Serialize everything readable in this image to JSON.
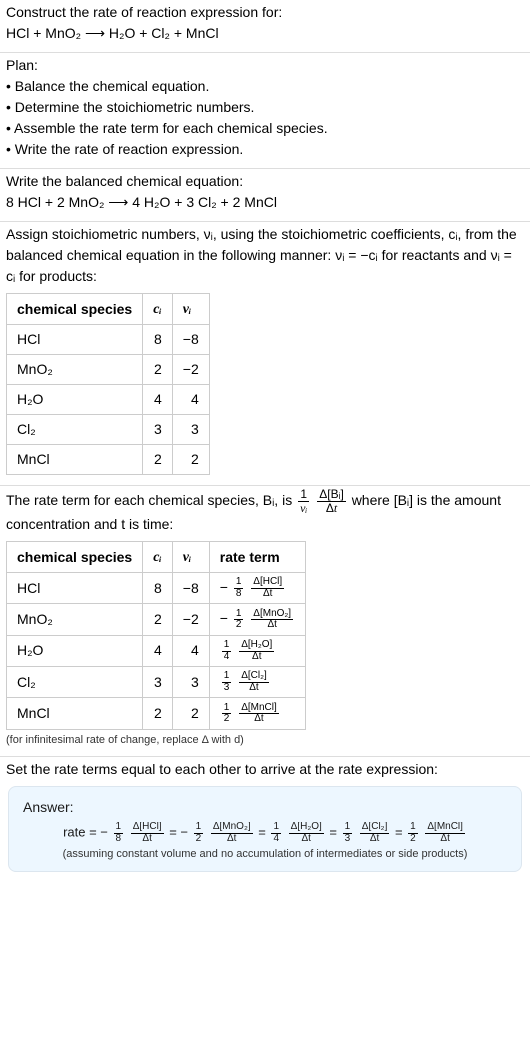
{
  "prompt": {
    "line1": "Construct the rate of reaction expression for:",
    "eq": "HCl + MnO₂ ⟶ H₂O + Cl₂ + MnCl"
  },
  "plan": {
    "heading": "Plan:",
    "items": [
      "• Balance the chemical equation.",
      "• Determine the stoichiometric numbers.",
      "• Assemble the rate term for each chemical species.",
      "• Write the rate of reaction expression."
    ]
  },
  "balanced": {
    "heading": "Write the balanced chemical equation:",
    "eq": "8 HCl + 2 MnO₂ ⟶ 4 H₂O + 3 Cl₂ + 2 MnCl"
  },
  "stoich": {
    "intro": "Assign stoichiometric numbers, νᵢ, using the stoichiometric coefficients, cᵢ, from the balanced chemical equation in the following manner: νᵢ = −cᵢ for reactants and νᵢ = cᵢ for products:",
    "headers": [
      "chemical species",
      "cᵢ",
      "νᵢ"
    ],
    "rows": [
      {
        "sp": "HCl",
        "c": "8",
        "v": "−8"
      },
      {
        "sp": "MnO₂",
        "c": "2",
        "v": "−2"
      },
      {
        "sp": "H₂O",
        "c": "4",
        "v": "4"
      },
      {
        "sp": "Cl₂",
        "c": "3",
        "v": "3"
      },
      {
        "sp": "MnCl",
        "c": "2",
        "v": "2"
      }
    ]
  },
  "rateterm": {
    "intro_a": "The rate term for each chemical species, Bᵢ, is ",
    "intro_b": " where [Bᵢ] is the amount concentration and t is time:",
    "headers": [
      "chemical species",
      "cᵢ",
      "νᵢ",
      "rate term"
    ],
    "rows": [
      {
        "sp": "HCl",
        "c": "8",
        "v": "−8",
        "rt_sign": "−",
        "rt_num": "1",
        "rt_den": "8",
        "rt_dnum": "Δ[HCl]",
        "rt_dden": "Δt"
      },
      {
        "sp": "MnO₂",
        "c": "2",
        "v": "−2",
        "rt_sign": "−",
        "rt_num": "1",
        "rt_den": "2",
        "rt_dnum": "Δ[MnO₂]",
        "rt_dden": "Δt"
      },
      {
        "sp": "H₂O",
        "c": "4",
        "v": "4",
        "rt_sign": "",
        "rt_num": "1",
        "rt_den": "4",
        "rt_dnum": "Δ[H₂O]",
        "rt_dden": "Δt"
      },
      {
        "sp": "Cl₂",
        "c": "3",
        "v": "3",
        "rt_sign": "",
        "rt_num": "1",
        "rt_den": "3",
        "rt_dnum": "Δ[Cl₂]",
        "rt_dden": "Δt"
      },
      {
        "sp": "MnCl",
        "c": "2",
        "v": "2",
        "rt_sign": "",
        "rt_num": "1",
        "rt_den": "2",
        "rt_dnum": "Δ[MnCl]",
        "rt_dden": "Δt"
      }
    ],
    "note": "(for infinitesimal rate of change, replace Δ with d)"
  },
  "final": {
    "heading": "Set the rate terms equal to each other to arrive at the rate expression:",
    "answer_label": "Answer:",
    "terms": [
      {
        "sign": "−",
        "num": "1",
        "den": "8",
        "dnum": "Δ[HCl]",
        "dden": "Δt"
      },
      {
        "sign": "−",
        "num": "1",
        "den": "2",
        "dnum": "Δ[MnO₂]",
        "dden": "Δt"
      },
      {
        "sign": "",
        "num": "1",
        "den": "4",
        "dnum": "Δ[H₂O]",
        "dden": "Δt"
      },
      {
        "sign": "",
        "num": "1",
        "den": "3",
        "dnum": "Δ[Cl₂]",
        "dden": "Δt"
      },
      {
        "sign": "",
        "num": "1",
        "den": "2",
        "dnum": "Δ[MnCl]",
        "dden": "Δt"
      }
    ],
    "rate_label": "rate = ",
    "assumption": "(assuming constant volume and no accumulation of intermediates or side products)"
  }
}
